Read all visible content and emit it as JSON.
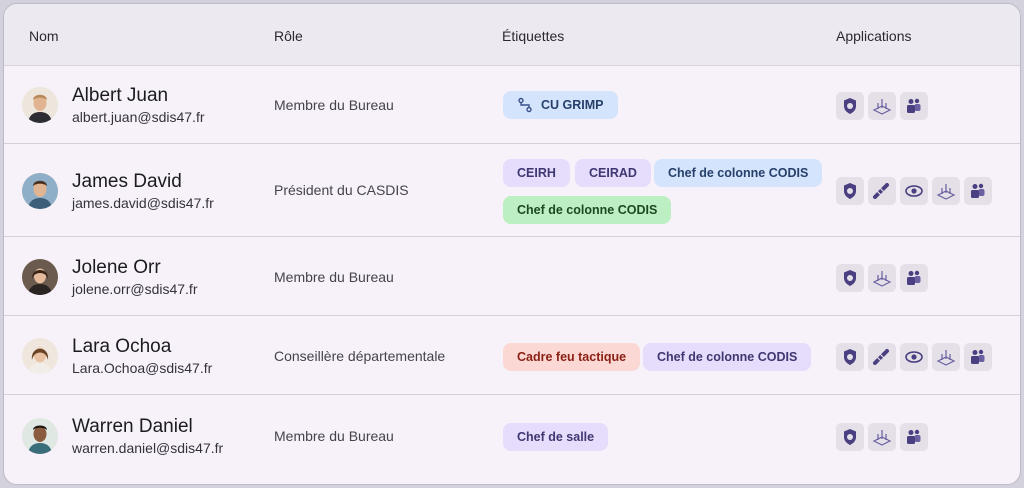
{
  "table": {
    "headers": {
      "name": "Nom",
      "role": "Rôle",
      "tags": "Étiquettes",
      "apps": "Applications"
    }
  },
  "colors": {
    "chip_purple": "#e6dcfb",
    "chip_blue": "#d4e4fc",
    "chip_green": "#bcefc1",
    "chip_red": "#fbd8d3",
    "app_tile": "#e5e0e8",
    "icon_accent": "#4a3f80"
  },
  "rows": [
    {
      "name": "Albert Juan",
      "email": "albert.juan@sdis47.fr",
      "role": "Membre du Bureau",
      "tags": [
        {
          "label": "CU GRIMP",
          "color": "blue",
          "icon": "route-icon"
        }
      ],
      "apps": [
        "shield-app-icon",
        "grid-app-icon",
        "teams-app-icon"
      ]
    },
    {
      "name": "James David",
      "email": "james.david@sdis47.fr",
      "role": "Président du CASDIS",
      "tags": [
        {
          "label": "CEIRH",
          "color": "purple"
        },
        {
          "label": "CEIRAD",
          "color": "purple"
        },
        {
          "label": "Chef de colonne CODIS",
          "color": "blue"
        },
        {
          "label": "Chef de colonne CODIS",
          "color": "green"
        }
      ],
      "apps": [
        "shield-app-icon",
        "hose-app-icon",
        "eye-app-icon",
        "grid-app-icon",
        "teams-app-icon"
      ]
    },
    {
      "name": "Jolene Orr",
      "email": "jolene.orr@sdis47.fr",
      "role": "Membre du Bureau",
      "tags": [],
      "apps": [
        "shield-app-icon",
        "grid-app-icon",
        "teams-app-icon"
      ]
    },
    {
      "name": "Lara Ochoa",
      "email": "Lara.Ochoa@sdis47.fr",
      "role": "Conseillère départementale",
      "tags": [
        {
          "label": "Cadre feu tactique",
          "color": "red"
        },
        {
          "label": "Chef de colonne CODIS",
          "color": "purple"
        }
      ],
      "apps": [
        "shield-app-icon",
        "hose-app-icon",
        "eye-app-icon",
        "grid-app-icon",
        "teams-app-icon"
      ]
    },
    {
      "name": "Warren Daniel",
      "email": "warren.daniel@sdis47.fr",
      "role": "Membre du Bureau",
      "tags": [
        {
          "label": "Chef de salle",
          "color": "purple"
        }
      ],
      "apps": [
        "shield-app-icon",
        "grid-app-icon",
        "teams-app-icon"
      ]
    }
  ]
}
